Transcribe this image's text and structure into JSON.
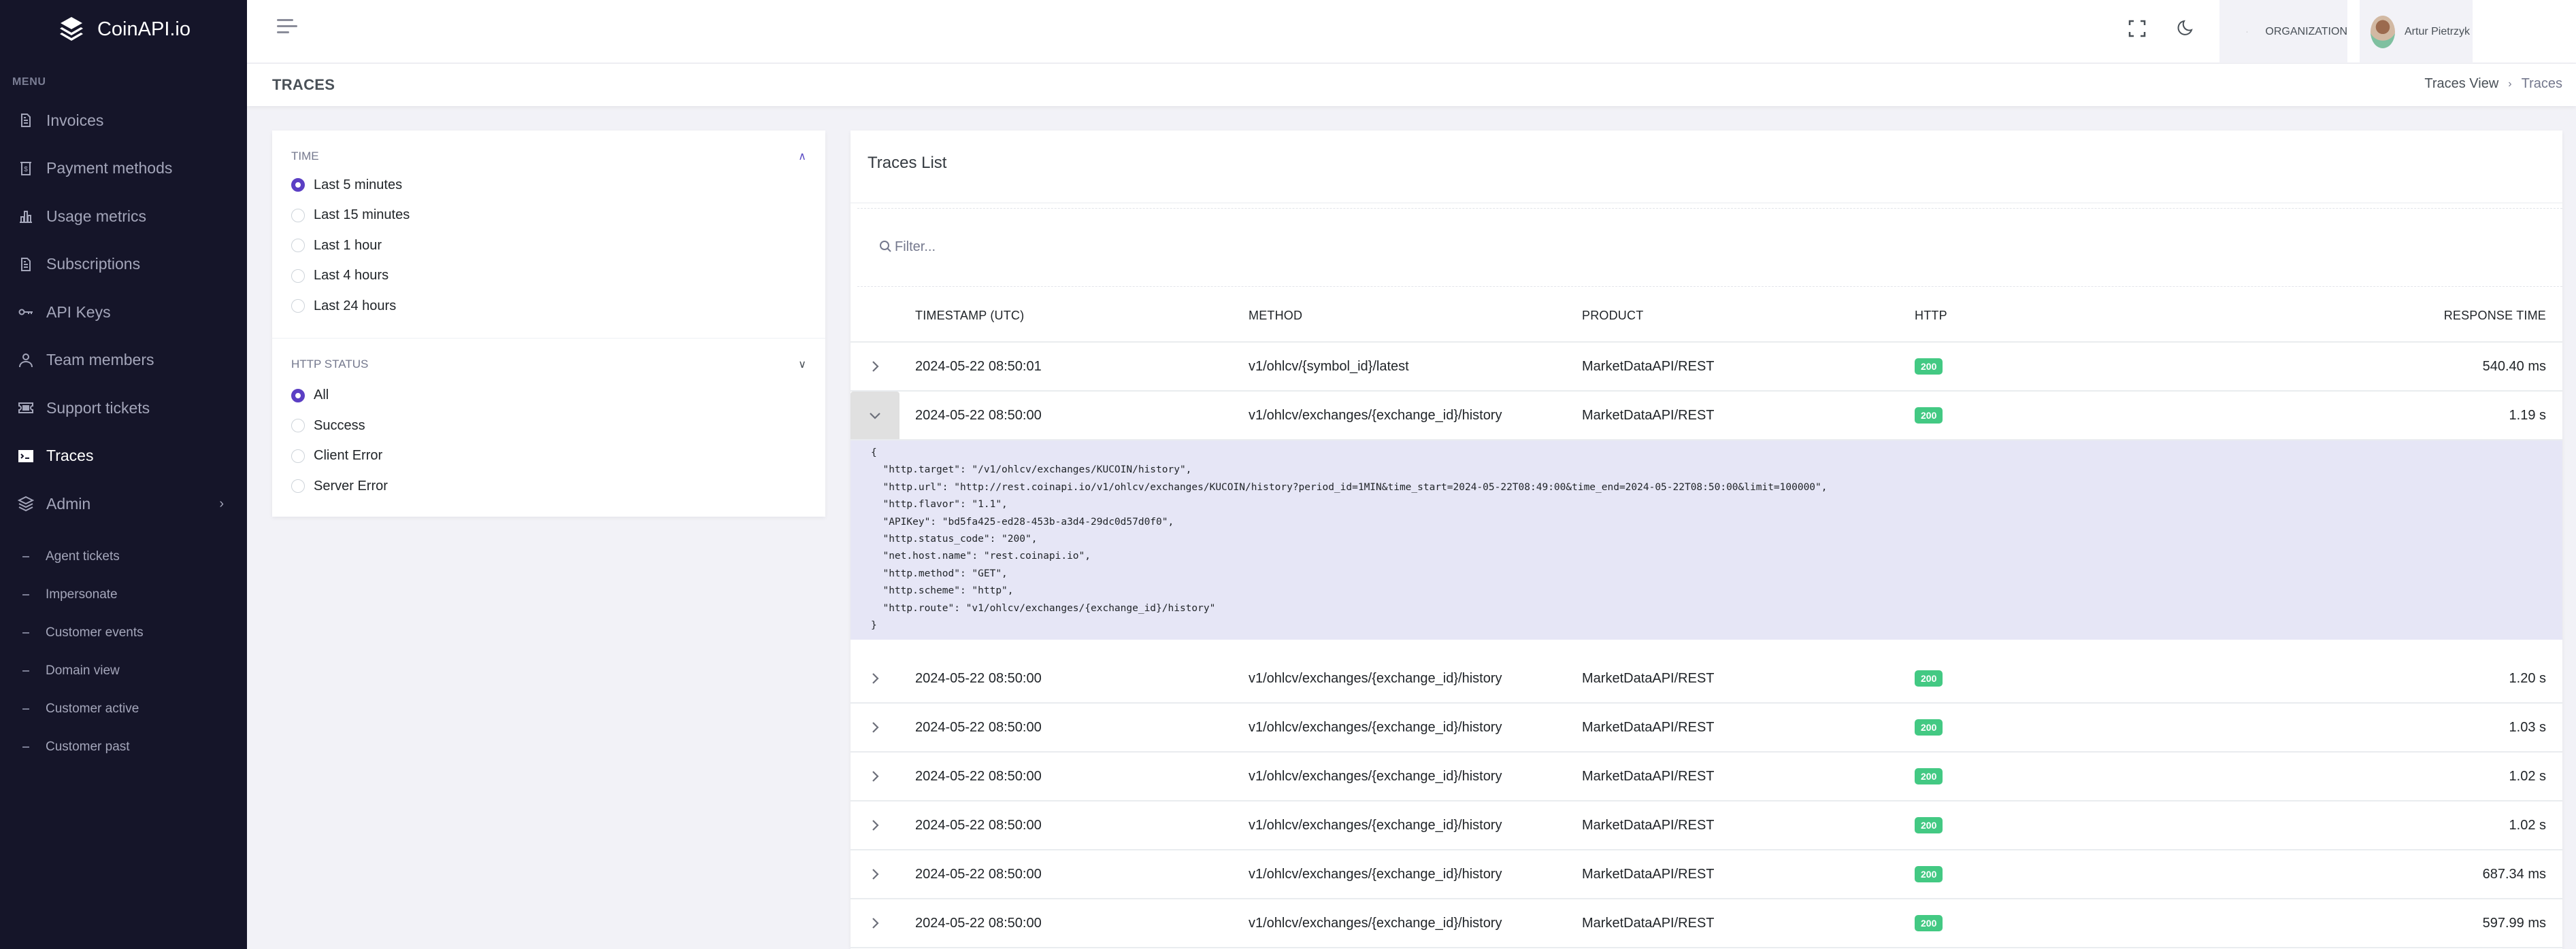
{
  "app": {
    "brand": "CoinAPI.io",
    "menu_title": "MENU"
  },
  "sidebar": {
    "items": [
      {
        "label": "Invoices",
        "icon": "file-text-icon"
      },
      {
        "label": "Payment methods",
        "icon": "dollar-receipt-icon"
      },
      {
        "label": "Usage metrics",
        "icon": "bar-chart-icon"
      },
      {
        "label": "Subscriptions",
        "icon": "file-text-icon"
      },
      {
        "label": "API Keys",
        "icon": "key-icon"
      },
      {
        "label": "Team members",
        "icon": "user-icon"
      },
      {
        "label": "Support tickets",
        "icon": "ticket-icon"
      },
      {
        "label": "Traces",
        "icon": "terminal-icon",
        "active": true
      },
      {
        "label": "Admin",
        "icon": "layers-icon",
        "expandable": true
      }
    ],
    "admin_subitems": [
      "Agent tickets",
      "Impersonate",
      "Customer events",
      "Domain view",
      "Customer active",
      "Customer past"
    ]
  },
  "topbar": {
    "organization_label": "ORGANIZATION",
    "user_name": "Artur Pietrzyk"
  },
  "page": {
    "title": "TRACES",
    "breadcrumb": [
      "Traces View",
      "Traces"
    ]
  },
  "filters": {
    "time": {
      "label": "TIME",
      "options": [
        "Last 5 minutes",
        "Last 15 minutes",
        "Last 1 hour",
        "Last 4 hours",
        "Last 24 hours"
      ],
      "selected": "Last 5 minutes"
    },
    "http_status": {
      "label": "HTTP STATUS",
      "options": [
        "All",
        "Success",
        "Client Error",
        "Server Error"
      ],
      "selected": "All"
    }
  },
  "traces": {
    "title": "Traces List",
    "filter_placeholder": "Filter...",
    "columns": [
      "TIMESTAMP (UTC)",
      "METHOD",
      "PRODUCT",
      "HTTP",
      "RESPONSE TIME"
    ],
    "rows": [
      {
        "timestamp": "2024-05-22 08:50:01",
        "method": "v1/ohlcv/{symbol_id}/latest",
        "product": "MarketDataAPI/REST",
        "http": "200",
        "response_time": "540.40 ms",
        "expanded": false
      },
      {
        "timestamp": "2024-05-22 08:50:00",
        "method": "v1/ohlcv/exchanges/{exchange_id}/history",
        "product": "MarketDataAPI/REST",
        "http": "200",
        "response_time": "1.19 s",
        "expanded": true
      },
      {
        "timestamp": "2024-05-22 08:50:00",
        "method": "v1/ohlcv/exchanges/{exchange_id}/history",
        "product": "MarketDataAPI/REST",
        "http": "200",
        "response_time": "1.20 s",
        "expanded": false
      },
      {
        "timestamp": "2024-05-22 08:50:00",
        "method": "v1/ohlcv/exchanges/{exchange_id}/history",
        "product": "MarketDataAPI/REST",
        "http": "200",
        "response_time": "1.03 s",
        "expanded": false
      },
      {
        "timestamp": "2024-05-22 08:50:00",
        "method": "v1/ohlcv/exchanges/{exchange_id}/history",
        "product": "MarketDataAPI/REST",
        "http": "200",
        "response_time": "1.02 s",
        "expanded": false
      },
      {
        "timestamp": "2024-05-22 08:50:00",
        "method": "v1/ohlcv/exchanges/{exchange_id}/history",
        "product": "MarketDataAPI/REST",
        "http": "200",
        "response_time": "1.02 s",
        "expanded": false
      },
      {
        "timestamp": "2024-05-22 08:50:00",
        "method": "v1/ohlcv/exchanges/{exchange_id}/history",
        "product": "MarketDataAPI/REST",
        "http": "200",
        "response_time": "687.34 ms",
        "expanded": false
      },
      {
        "timestamp": "2024-05-22 08:50:00",
        "method": "v1/ohlcv/exchanges/{exchange_id}/history",
        "product": "MarketDataAPI/REST",
        "http": "200",
        "response_time": "597.99 ms",
        "expanded": false
      }
    ],
    "expanded_detail": [
      "{",
      "  \"http.target\": \"/v1/ohlcv/exchanges/KUCOIN/history\",",
      "  \"http.url\": \"http://rest.coinapi.io/v1/ohlcv/exchanges/KUCOIN/history?period_id=1MIN&time_start=2024-05-22T08:49:00&time_end=2024-05-22T08:50:00&limit=100000\",",
      "  \"http.flavor\": \"1.1\",",
      "  \"APIKey\": \"bd5fa425-ed28-453b-a3d4-29dc0d57d0f0\",",
      "  \"http.status_code\": \"200\",",
      "  \"net.host.name\": \"rest.coinapi.io\",",
      "  \"http.method\": \"GET\",",
      "  \"http.scheme\": \"http\",",
      "  \"http.route\": \"v1/ohlcv/exchanges/{exchange_id}/history\"",
      "}"
    ]
  },
  "colors": {
    "sidebar_bg": "#151529",
    "accent": "#5b3fc4",
    "success_badge": "#43c983",
    "detail_bg": "#e6e6f6"
  }
}
